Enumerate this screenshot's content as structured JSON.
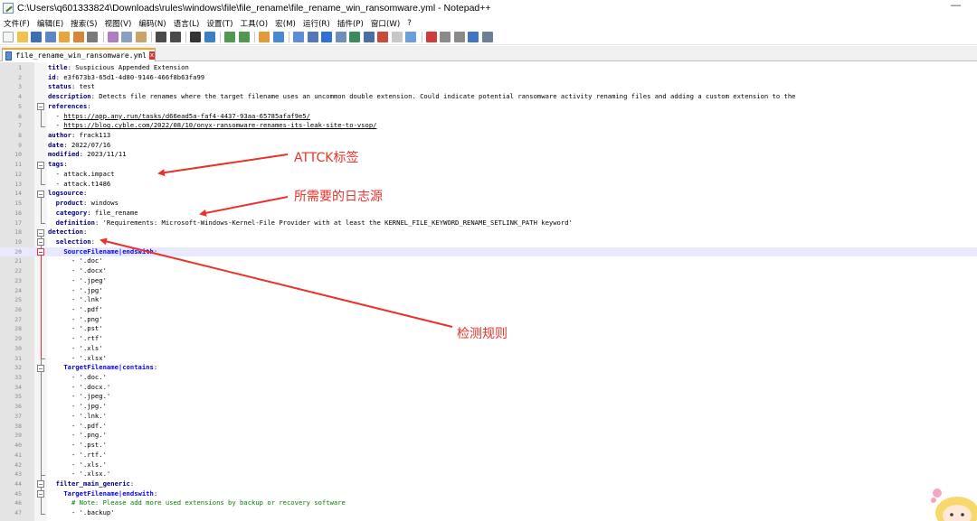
{
  "window": {
    "title": "C:\\Users\\q601333824\\Downloads\\rules\\windows\\file\\file_rename\\file_rename_win_ransomware.yml - Notepad++",
    "minimize": "—"
  },
  "menu": [
    "文件(F)",
    "编辑(E)",
    "搜索(S)",
    "视图(V)",
    "编码(N)",
    "语言(L)",
    "设置(T)",
    "工具(O)",
    "宏(M)",
    "运行(R)",
    "插件(P)",
    "窗口(W)",
    "?"
  ],
  "tab": {
    "label": "file_rename_win_ransomware.yml",
    "close": "x"
  },
  "lines": [
    "title: Suspicious Appended Extension",
    "id: e3f673b3-65d1-4d80-9146-466f8b63fa99",
    "status: test",
    "description: Detects file renames where the target filename uses an uncommon double extension. Could indicate potential ransomware activity renaming files and adding a custom extension to the",
    "references:",
    "  - https://app.any.run/tasks/d66ead5a-faf4-4437-93aa-65785afaf9e5/",
    "  - https://blog.cyble.com/2022/08/10/onyx-ransomware-renames-its-leak-site-to-vsop/",
    "author: frack113",
    "date: 2022/07/16",
    "modified: 2023/11/11",
    "tags:",
    "  - attack.impact",
    "  - attack.t1486",
    "logsource:",
    "  product: windows",
    "  category: file_rename",
    "  definition: 'Requirements: Microsoft-Windows-Kernel-File Provider with at least the KERNEL_FILE_KEYWORD_RENAME_SETLINK_PATH keyword'",
    "detection:",
    "  selection:",
    "    SourceFilename|endswith:",
    "      - '.doc'",
    "      - '.docx'",
    "      - '.jpeg'",
    "      - '.jpg'",
    "      - '.lnk'",
    "      - '.pdf'",
    "      - '.png'",
    "      - '.pst'",
    "      - '.rtf'",
    "      - '.xls'",
    "      - '.xlsx'",
    "    TargetFilename|contains:",
    "      - '.doc.'",
    "      - '.docx.'",
    "      - '.jpeg.'",
    "      - '.jpg.'",
    "      - '.lnk.'",
    "      - '.pdf.'",
    "      - '.png.'",
    "      - '.pst.'",
    "      - '.rtf.'",
    "      - '.xls.'",
    "      - '.xlsx.'",
    "  filter_main_generic:",
    "    TargetFilename|endswith:",
    "      # Note: Please add more used extensions by backup or recovery software",
    "      - '.backup'"
  ],
  "annotations": {
    "tags": "ATTCK标签",
    "logsource": "所需要的日志源",
    "detection": "检测规则"
  },
  "colors": {
    "annotation": "#e8332a",
    "key": "#000080",
    "comment": "#008000",
    "current_line": "#e8e8ff"
  }
}
